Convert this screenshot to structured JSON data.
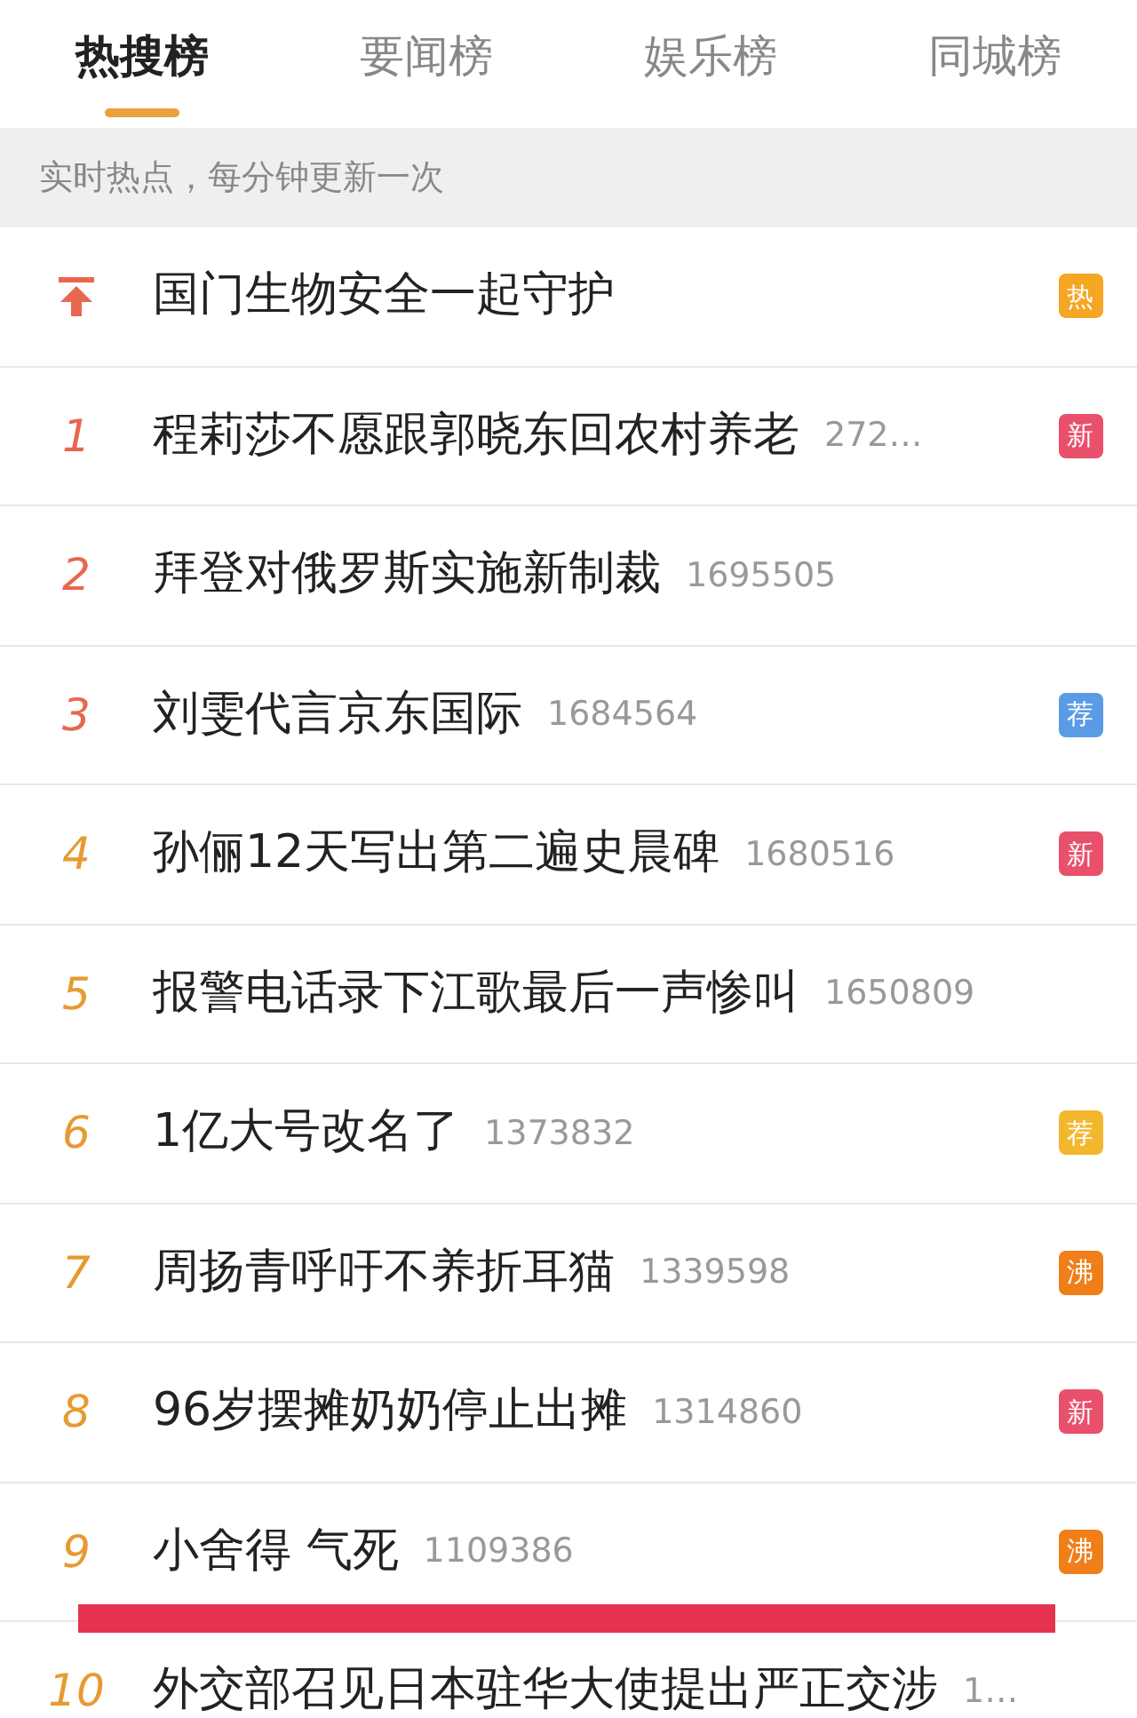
{
  "tabs": [
    {
      "label": "热搜榜",
      "selected": true
    },
    {
      "label": "要闻榜",
      "selected": false
    },
    {
      "label": "娱乐榜",
      "selected": false
    },
    {
      "label": "同城榜",
      "selected": false
    }
  ],
  "notice": "实时热点，每分钟更新一次",
  "rows": [
    {
      "kind": "pinned",
      "title": "国门生物安全一起守护",
      "badge": {
        "text": "热",
        "color": "#f5a623"
      },
      "marked": false
    },
    {
      "kind": "ranked",
      "rank": "1",
      "top": true,
      "title": "程莉莎不愿跟郭晓东回农村养老",
      "count": "272…",
      "badge": {
        "text": "新",
        "color": "#e9506b"
      },
      "marked": false
    },
    {
      "kind": "ranked",
      "rank": "2",
      "top": true,
      "title": "拜登对俄罗斯实施新制裁",
      "count": "1695505",
      "marked": false
    },
    {
      "kind": "ranked",
      "rank": "3",
      "top": true,
      "title": "刘雯代言京东国际",
      "count": "1684564",
      "badge": {
        "text": "荐",
        "color": "#5b9be6"
      },
      "marked": false
    },
    {
      "kind": "ranked",
      "rank": "4",
      "top": false,
      "title": "孙俪12天写出第二遍史晨碑",
      "count": "1680516",
      "badge": {
        "text": "新",
        "color": "#e9506b"
      },
      "marked": false
    },
    {
      "kind": "ranked",
      "rank": "5",
      "top": false,
      "title": "报警电话录下江歌最后一声惨叫",
      "count": "1650809",
      "marked": false
    },
    {
      "kind": "ranked",
      "rank": "6",
      "top": false,
      "title": "1亿大号改名了",
      "count": "1373832",
      "badge": {
        "text": "荐",
        "color": "#f3b72e"
      },
      "marked": false
    },
    {
      "kind": "ranked",
      "rank": "7",
      "top": false,
      "title": "周扬青呼吁不养折耳猫",
      "count": "1339598",
      "badge": {
        "text": "沸",
        "color": "#f07f19"
      },
      "marked": false
    },
    {
      "kind": "ranked",
      "rank": "8",
      "top": false,
      "title": "96岁摆摊奶奶停止出摊",
      "count": "1314860",
      "badge": {
        "text": "新",
        "color": "#e9506b"
      },
      "marked": false
    },
    {
      "kind": "ranked",
      "rank": "9",
      "top": false,
      "title": "小舍得 气死",
      "count": "1109386",
      "badge": {
        "text": "沸",
        "color": "#f07f19"
      },
      "marked": true
    },
    {
      "kind": "ranked",
      "rank": "10",
      "top": false,
      "title": "外交部召见日本驻华大使提出严正交涉",
      "count": "1…",
      "marked": false
    }
  ]
}
